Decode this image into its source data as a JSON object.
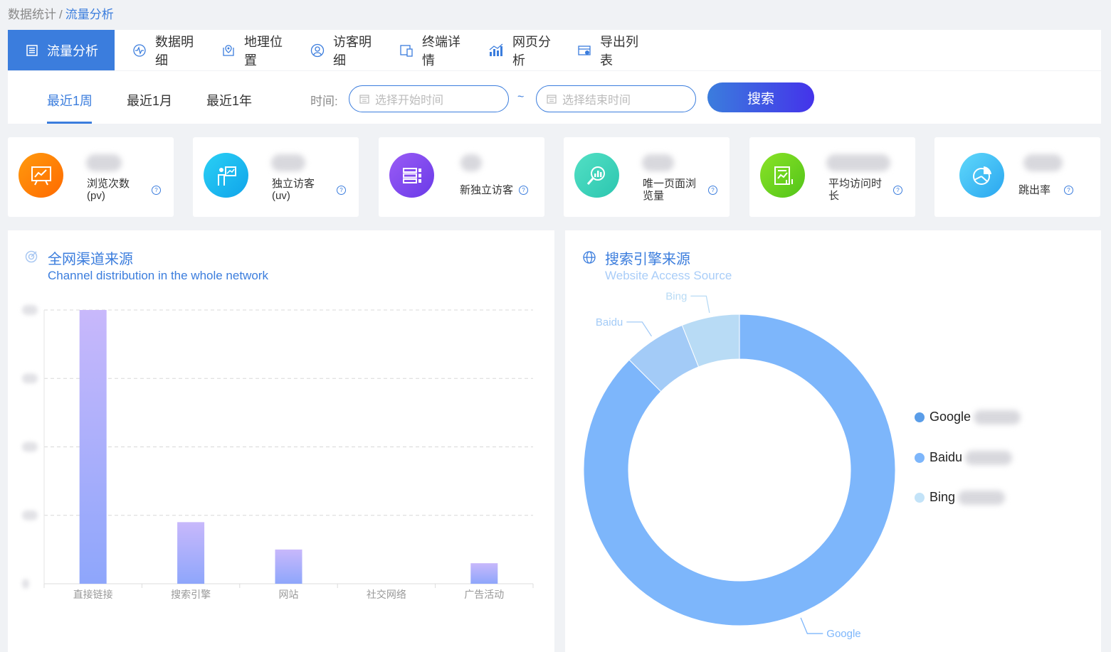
{
  "breadcrumb": {
    "parent": "数据统计",
    "separator": "/",
    "current": "流量分析"
  },
  "nav": {
    "tabs": [
      {
        "label": "流量分析",
        "icon": "document-icon"
      },
      {
        "label": "数据明细",
        "icon": "pulse-icon"
      },
      {
        "label": "地理位置",
        "icon": "map-pin-icon"
      },
      {
        "label": "访客明细",
        "icon": "user-icon"
      },
      {
        "label": "终端详情",
        "icon": "device-icon"
      },
      {
        "label": "网页分析",
        "icon": "bar-chart-icon"
      },
      {
        "label": "导出列表",
        "icon": "export-icon"
      }
    ],
    "active": 0
  },
  "filter": {
    "periods": [
      "最近1周",
      "最近1月",
      "最近1年"
    ],
    "active_period": 0,
    "time_label": "时间:",
    "start_placeholder": "选择开始时间",
    "end_placeholder": "选择结束时间",
    "range_separator": "~",
    "search_label": "搜索"
  },
  "stats": [
    {
      "label1": "浏览次数",
      "label2": "(pv)",
      "icon": "presentation-icon",
      "color_from": "#ff9a0e",
      "color_to": "#ff6a00"
    },
    {
      "label1": "独立访客",
      "label2": "(uv)",
      "icon": "presenter-icon",
      "color_from": "#2ad0f5",
      "color_to": "#10a4ea"
    },
    {
      "label1": "新独立访客",
      "label2": "",
      "icon": "server-icon",
      "color_from": "#9a5cf5",
      "color_to": "#6a3ae8"
    },
    {
      "label1": "唯一页面浏",
      "label2": "览量",
      "icon": "magnifier-chart-icon",
      "color_from": "#52e0c4",
      "color_to": "#2cc6b0"
    },
    {
      "label1": "平均访问时",
      "label2": "长",
      "icon": "report-icon",
      "color_from": "#8ae326",
      "color_to": "#52c41a"
    },
    {
      "label1": "跳出率",
      "label2": "",
      "icon": "pie-icon",
      "color_from": "#5fd8fa",
      "color_to": "#2aa6f0"
    }
  ],
  "channel_panel": {
    "title": "全网渠道来源",
    "subtitle": "Channel distribution in the whole network",
    "icon": "target-icon"
  },
  "search_panel": {
    "title": "搜索引擎来源",
    "subtitle": "Website Access Source",
    "icon": "globe-icon"
  },
  "chart_data": [
    {
      "type": "bar",
      "categories": [
        "直接链接",
        "搜索引擎",
        "网站",
        "社交网络",
        "广告活动"
      ],
      "values": [
        100,
        22.5,
        12.5,
        0,
        7.5
      ],
      "ylim": [
        0,
        100
      ],
      "grid": true,
      "colors": {
        "bar_top": "#c8b8fb",
        "bar_bottom": "#8ea6fb"
      }
    },
    {
      "type": "pie",
      "labels": [
        "Google",
        "Baidu",
        "Bing"
      ],
      "values": [
        87.5,
        6.5,
        6
      ],
      "colors": [
        "#7db6fb",
        "#a3cbf7",
        "#b8dbf5"
      ],
      "legend_colors": [
        "#5a9de8",
        "#7db6fb",
        "#c3e3f8"
      ],
      "legend": "right"
    }
  ]
}
